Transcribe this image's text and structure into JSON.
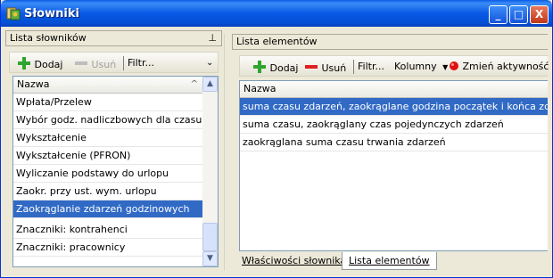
{
  "window": {
    "title": "Słowniki",
    "controls": [
      "_",
      "□",
      "X"
    ]
  },
  "left_panel": {
    "header": "Lista słowników",
    "pin_glyph": "⊥",
    "toolbar": {
      "add_label": "Dodaj",
      "remove_label": "Usuń",
      "filter_label": "Filtr...",
      "overflow_glyph": "⌄"
    },
    "grid": {
      "column_header": "Nazwa",
      "sort_glyph": "^",
      "rows": [
        "Wpłata/Przelew",
        "Wybór godz. nadliczbowych dla czasu w...",
        "Wykształcenie",
        "Wykształcenie (PFRON)",
        "Wyliczanie podstawy do urlopu",
        "Zaokr. przy ust. wym. urlopu",
        "Zaokrąglanie zdarzeń godzinowych",
        "Znaczniki: kontrahenci",
        "Znaczniki: pracownicy"
      ],
      "selected_index": 6
    }
  },
  "right_panel": {
    "header": "Lista elementów",
    "toolbar": {
      "add_label": "Dodaj",
      "remove_label": "Usuń",
      "filter_label": "Filtr...",
      "columns_label": "Kolumny",
      "toggle_active_label": "Zmień aktywność"
    },
    "grid": {
      "column_header": "Nazwa",
      "rows": [
        "suma czasu zdarzeń,  zaokrąglane godzina początek i końca zdarzenia",
        "suma czasu, zaokrąglany czas pojedynczych zdarzeń",
        "zaokrąglana suma czasu trwania zdarzeń"
      ],
      "selected_index": 0
    },
    "tabs": [
      {
        "label": "Właściwości słownika",
        "active": false
      },
      {
        "label": "Lista elementów",
        "active": true
      }
    ]
  },
  "colors": {
    "selection": "#316ac5",
    "titlebar": "#0958e6",
    "add_icon": "#2ea52e",
    "remove_icon": "#e02020",
    "active_icon": "#e01010"
  }
}
